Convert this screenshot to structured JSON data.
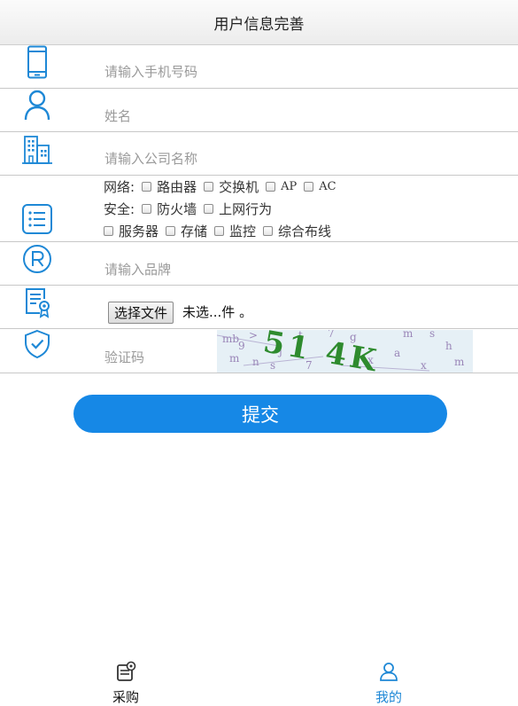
{
  "header": {
    "title": "用户信息完善"
  },
  "form": {
    "phone_placeholder": "请输入手机号码",
    "name_placeholder": "姓名",
    "company_placeholder": "请输入公司名称",
    "network": {
      "label": "网络:",
      "options": [
        "路由器",
        "交换机",
        "AP",
        "AC"
      ]
    },
    "security": {
      "label": "安全:",
      "options": [
        "防火墙",
        "上网行为"
      ]
    },
    "other": {
      "options": [
        "服务器",
        "存储",
        "监控",
        "综合布线"
      ]
    },
    "brand_placeholder": "请输入品牌",
    "file_button": "选择文件",
    "file_status": "未选...件 。",
    "captcha_placeholder": "验证码",
    "captcha_text": "51 4K",
    "submit_label": "提交"
  },
  "icons": {
    "phone": "phone-icon",
    "user": "user-icon",
    "company": "building-icon",
    "interests": "list-icon",
    "brand": "registered-icon",
    "certificate": "certificate-icon",
    "captcha": "shield-check-icon"
  },
  "tabbar": {
    "items": [
      {
        "label": "采购",
        "icon": "purchase-icon",
        "active": false
      },
      {
        "label": "我的",
        "icon": "user-icon",
        "active": true
      }
    ]
  },
  "colors": {
    "accent": "#1688e6",
    "icon": "#1e88d6",
    "captcha_green": "#2e8b2e"
  }
}
